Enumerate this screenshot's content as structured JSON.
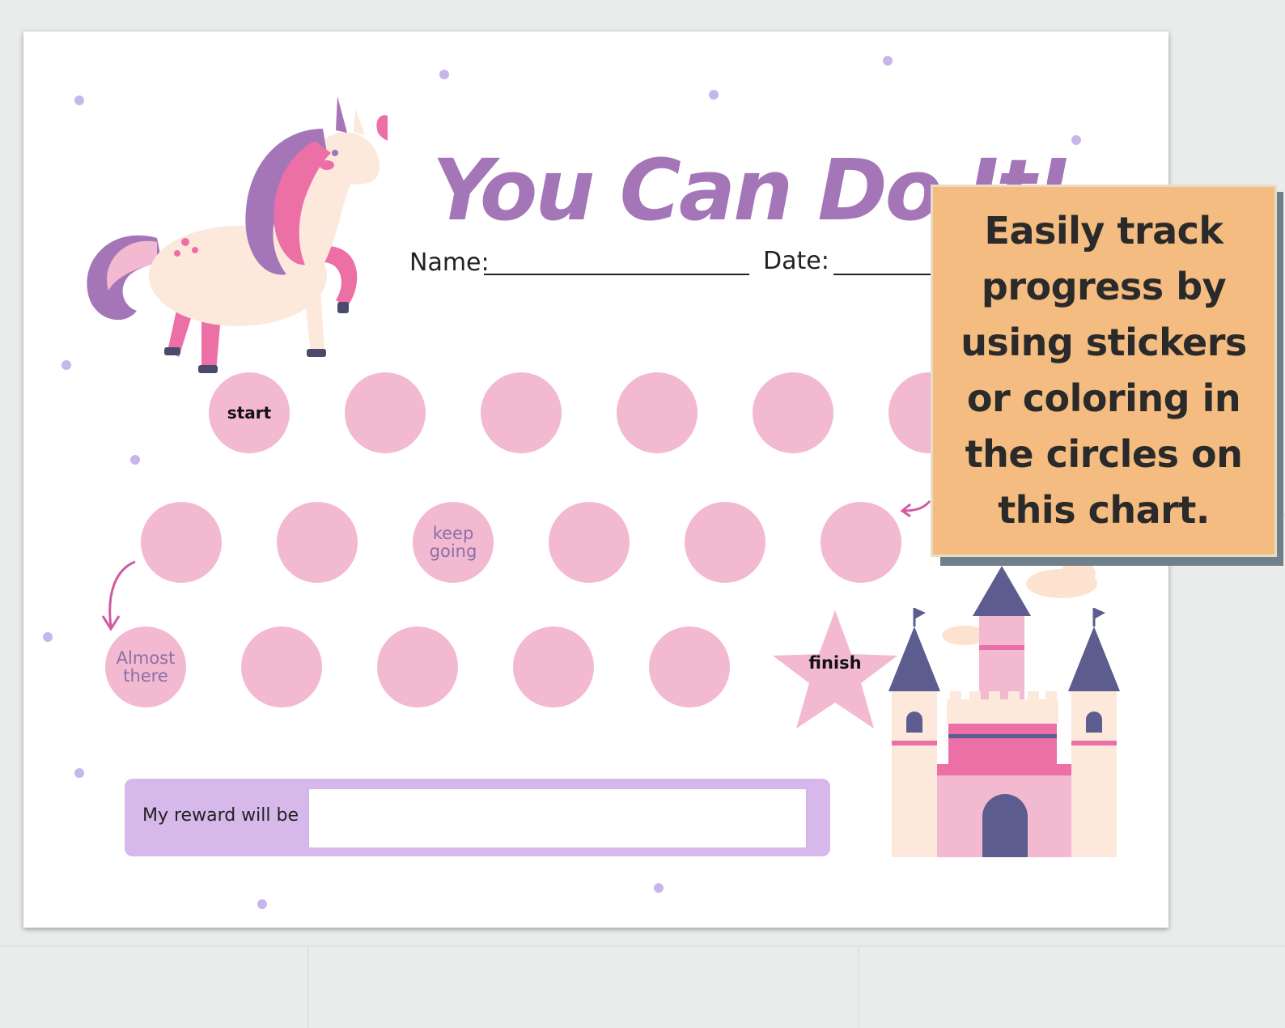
{
  "chart": {
    "title": "You Can Do It!",
    "name_label": "Name:",
    "date_label": "Date:",
    "row1_start_label": "start",
    "row2_label": [
      "keep",
      "going"
    ],
    "row3_label": [
      "Almost",
      "there"
    ],
    "finish_label": "finish",
    "reward_label": "My reward will be"
  },
  "callout": {
    "text": "Easily track progress by using stickers or coloring in the circles on this chart."
  },
  "colors": {
    "title": "#a476b8",
    "circle": "#f2b9d0",
    "reward_bar": "#d6b8ea",
    "callout": "#f4bc80",
    "callout_shadow": "#6f7f8c"
  },
  "illustrations": {
    "top_left": "unicorn-illustration",
    "bottom_right": "castle-illustration"
  }
}
